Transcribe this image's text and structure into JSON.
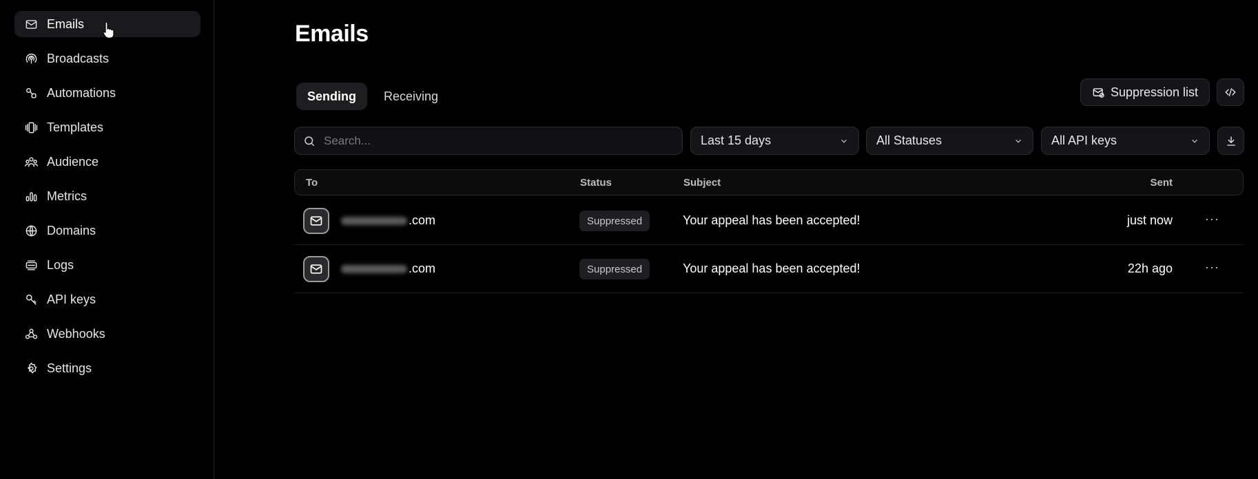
{
  "sidebar": {
    "items": [
      {
        "label": "Emails",
        "icon": "mail-icon",
        "active": true
      },
      {
        "label": "Broadcasts",
        "icon": "broadcast-icon"
      },
      {
        "label": "Automations",
        "icon": "automation-icon"
      },
      {
        "label": "Templates",
        "icon": "templates-icon"
      },
      {
        "label": "Audience",
        "icon": "audience-icon"
      },
      {
        "label": "Metrics",
        "icon": "metrics-icon"
      },
      {
        "label": "Domains",
        "icon": "globe-icon"
      },
      {
        "label": "Logs",
        "icon": "logs-icon"
      },
      {
        "label": "API keys",
        "icon": "key-icon"
      },
      {
        "label": "Webhooks",
        "icon": "webhook-icon"
      },
      {
        "label": "Settings",
        "icon": "gear-icon"
      }
    ]
  },
  "main": {
    "title": "Emails",
    "tabs": [
      {
        "label": "Sending",
        "active": true
      },
      {
        "label": "Receiving"
      }
    ],
    "suppression_label": "Suppression list",
    "search_placeholder": "Search...",
    "filters": {
      "date": "Last 15 days",
      "status": "All Statuses",
      "api_keys": "All API keys"
    },
    "table": {
      "columns": {
        "to": "To",
        "status": "Status",
        "subject": "Subject",
        "sent": "Sent"
      },
      "rows": [
        {
          "to_suffix": ".com",
          "status": "Suppressed",
          "subject": "Your appeal has been accepted!",
          "sent": "just now",
          "more": "···"
        },
        {
          "to_suffix": ".com",
          "status": "Suppressed",
          "subject": "Your appeal has been accepted!",
          "sent": "22h ago",
          "more": "···"
        }
      ]
    }
  },
  "colors": {
    "background": "#000000",
    "surface": "#151517",
    "border": "#2c2c2e"
  }
}
